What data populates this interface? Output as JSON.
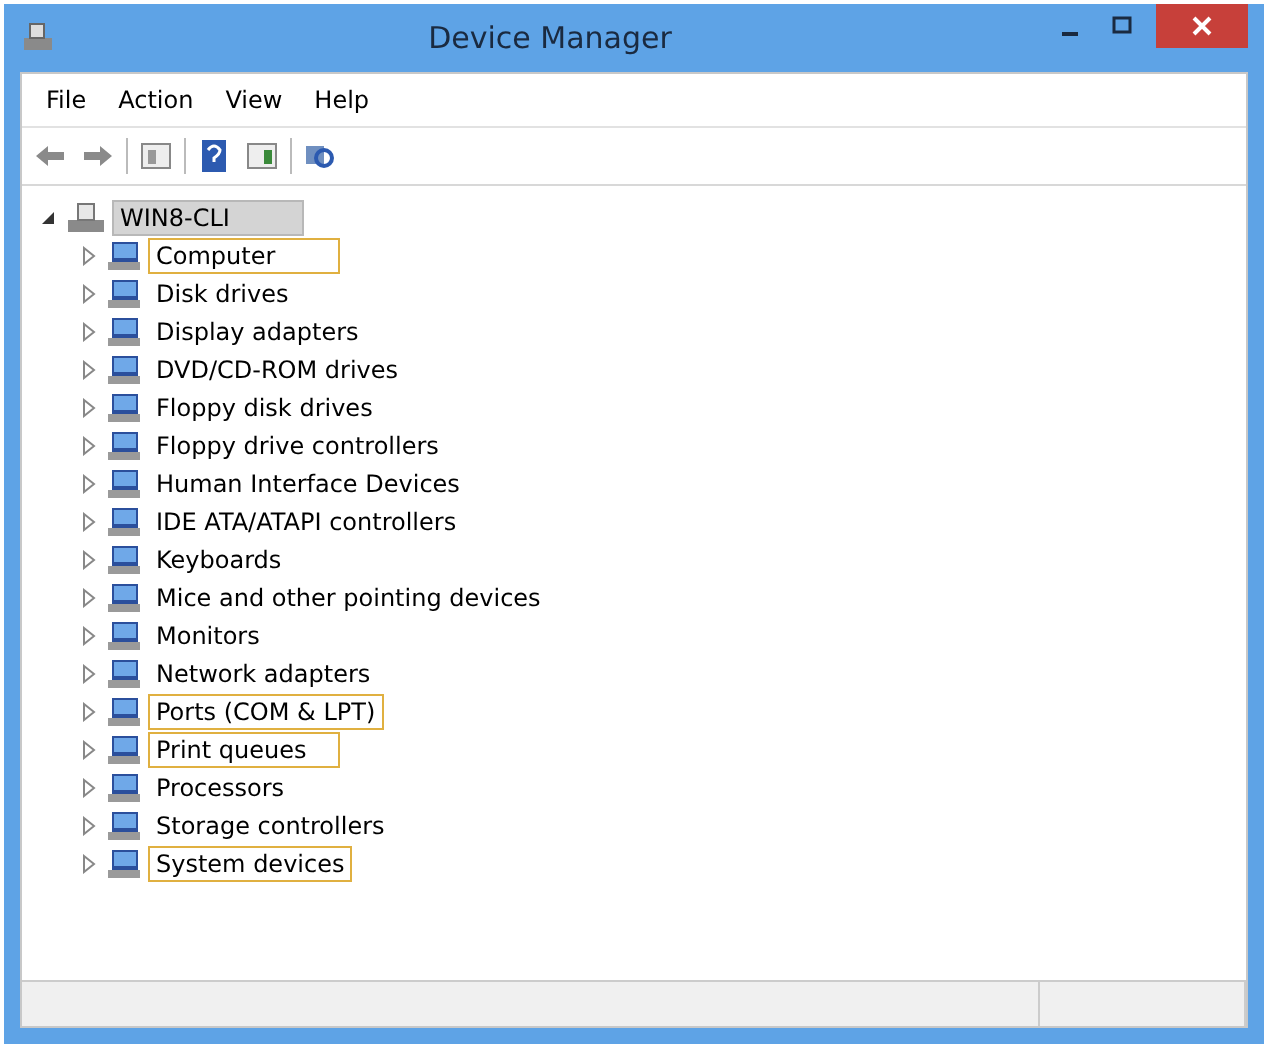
{
  "window": {
    "title": "Device Manager"
  },
  "menu": [
    "File",
    "Action",
    "View",
    "Help"
  ],
  "tree": {
    "label": "WIN8-CLI",
    "selected": true,
    "expanded": true,
    "children": [
      {
        "label": "Computer",
        "highlighted": true
      },
      {
        "label": "Disk drives",
        "highlighted": false
      },
      {
        "label": "Display adapters",
        "highlighted": false
      },
      {
        "label": "DVD/CD-ROM drives",
        "highlighted": false
      },
      {
        "label": "Floppy disk drives",
        "highlighted": false
      },
      {
        "label": "Floppy drive controllers",
        "highlighted": false
      },
      {
        "label": "Human Interface Devices",
        "highlighted": false
      },
      {
        "label": "IDE ATA/ATAPI controllers",
        "highlighted": false
      },
      {
        "label": "Keyboards",
        "highlighted": false
      },
      {
        "label": "Mice and other pointing devices",
        "highlighted": false
      },
      {
        "label": "Monitors",
        "highlighted": false
      },
      {
        "label": "Network adapters",
        "highlighted": false
      },
      {
        "label": "Ports (COM & LPT)",
        "highlighted": true
      },
      {
        "label": "Print queues",
        "highlighted": true
      },
      {
        "label": "Processors",
        "highlighted": false
      },
      {
        "label": "Storage controllers",
        "highlighted": false
      },
      {
        "label": "System devices",
        "highlighted": true
      }
    ]
  }
}
